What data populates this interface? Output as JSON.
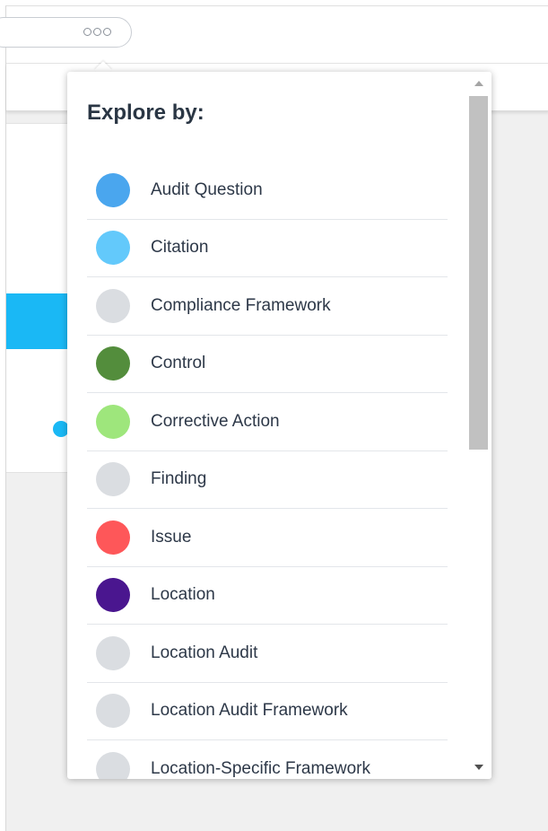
{
  "popover": {
    "title": "Explore by:",
    "items": [
      {
        "label": "Audit Question",
        "color": "#4aa6ee"
      },
      {
        "label": "Citation",
        "color": "#63c9fb"
      },
      {
        "label": "Compliance Framework",
        "color": "#dadde1"
      },
      {
        "label": "Control",
        "color": "#538d3c"
      },
      {
        "label": "Corrective Action",
        "color": "#9ee67c"
      },
      {
        "label": "Finding",
        "color": "#dadde1"
      },
      {
        "label": "Issue",
        "color": "#fe5759"
      },
      {
        "label": "Location",
        "color": "#4a168f"
      },
      {
        "label": "Location Audit",
        "color": "#dadde1"
      },
      {
        "label": "Location Audit Framework",
        "color": "#dadde1"
      },
      {
        "label": "Location-Specific Framework",
        "color": "#dadde1"
      }
    ]
  },
  "toolbar": {
    "more_icon": "more-horizontal-icon"
  },
  "colors": {
    "accent": "#1ab8f5"
  }
}
